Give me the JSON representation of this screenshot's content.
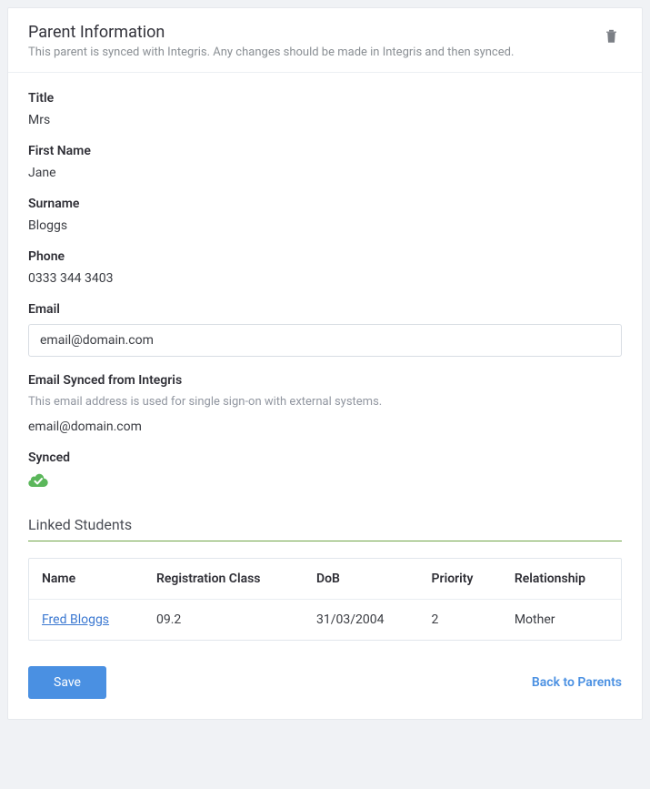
{
  "header": {
    "title": "Parent Information",
    "subtitle": "This parent is synced with Integris. Any changes should be made in Integris and then synced."
  },
  "fields": {
    "title_label": "Title",
    "title_value": "Mrs",
    "firstname_label": "First Name",
    "firstname_value": "Jane",
    "surname_label": "Surname",
    "surname_value": "Bloggs",
    "phone_label": "Phone",
    "phone_value": "0333 344 3403",
    "email_label": "Email",
    "email_value": "email@domain.com",
    "synced_email_label": "Email Synced from Integris",
    "synced_email_helper": "This email address is used for single sign-on with external systems.",
    "synced_email_value": "email@domain.com",
    "synced_label": "Synced"
  },
  "linked_students": {
    "section_title": "Linked Students",
    "columns": {
      "name": "Name",
      "reg_class": "Registration Class",
      "dob": "DoB",
      "priority": "Priority",
      "relationship": "Relationship"
    },
    "rows": [
      {
        "name": "Fred Bloggs",
        "reg_class": "09.2",
        "dob": "31/03/2004",
        "priority": "2",
        "relationship": "Mother"
      }
    ]
  },
  "footer": {
    "save_label": "Save",
    "back_label": "Back to Parents"
  }
}
